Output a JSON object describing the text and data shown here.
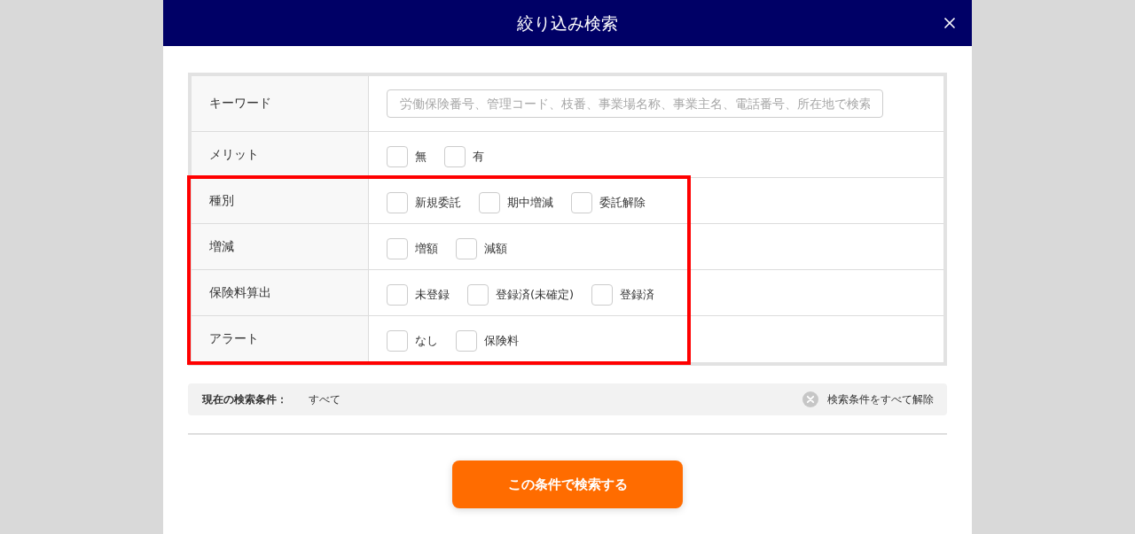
{
  "dialog": {
    "title": "絞り込み検索"
  },
  "filters": [
    {
      "kind": "text",
      "label": "キーワード",
      "placeholder": "労働保険番号、管理コード、枝番、事業場名称、事業主名、電話番号、所在地で検索",
      "highlighted": false
    },
    {
      "kind": "checkboxes",
      "label": "メリット",
      "highlighted": false,
      "options": [
        {
          "label": "無",
          "checked": false
        },
        {
          "label": "有",
          "checked": false
        }
      ]
    },
    {
      "kind": "checkboxes",
      "label": "種別",
      "highlighted": true,
      "options": [
        {
          "label": "新規委託",
          "checked": false
        },
        {
          "label": "期中増減",
          "checked": false
        },
        {
          "label": "委託解除",
          "checked": false
        }
      ]
    },
    {
      "kind": "checkboxes",
      "label": "増減",
      "highlighted": true,
      "options": [
        {
          "label": "増額",
          "checked": false
        },
        {
          "label": "減額",
          "checked": false
        }
      ]
    },
    {
      "kind": "checkboxes",
      "label": "保険料算出",
      "highlighted": true,
      "options": [
        {
          "label": "未登録",
          "checked": false
        },
        {
          "label": "登録済(未確定)",
          "checked": false
        },
        {
          "label": "登録済",
          "checked": false
        }
      ]
    },
    {
      "kind": "checkboxes",
      "label": "アラート",
      "highlighted": true,
      "options": [
        {
          "label": "なし",
          "checked": false
        },
        {
          "label": "保険料",
          "checked": false
        }
      ]
    }
  ],
  "current_conditions": {
    "label": "現在の検索条件：",
    "value": "すべて",
    "clear_label": "検索条件をすべて解除"
  },
  "submit_label": "この条件で検索する"
}
